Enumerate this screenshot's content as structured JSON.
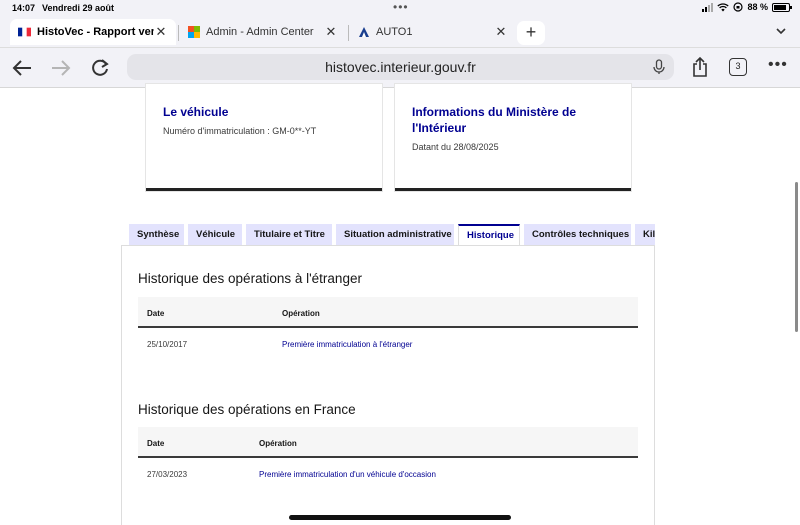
{
  "status": {
    "time": "14:07",
    "date": "Vendredi 29 août",
    "battery": "88 %",
    "battery_level": 0.88
  },
  "browser": {
    "tabs": [
      {
        "title": "HistoVec - Rapport vendeur",
        "icon": "french-flag-icon"
      },
      {
        "title": "Admin - Admin Center",
        "icon": "office-logo-icon"
      },
      {
        "title": "AUTO1",
        "icon": "auto1-logo-icon"
      }
    ],
    "url": "histovec.interieur.gouv.fr",
    "tab_count": "3"
  },
  "cards": {
    "vehicle": {
      "title": "Le véhicule",
      "subtitle": "Numéro d'immatriculation : GM-0**-YT"
    },
    "ministry": {
      "title": "Informations du Ministère de l'Intérieur",
      "subtitle": "Datant du 28/08/2025"
    }
  },
  "nav_tabs": [
    "Synthèse",
    "Véhicule",
    "Titulaire et Titre",
    "Situation administrative",
    "Historique",
    "Contrôles techniques",
    "Kilométrage"
  ],
  "active_nav_tab": "Historique",
  "history_abroad": {
    "title": "Historique des opérations à l'étranger",
    "columns": [
      "Date",
      "Opération"
    ],
    "rows": [
      {
        "date": "25/10/2017",
        "operation": "Première immatriculation à l'étranger"
      }
    ]
  },
  "history_france": {
    "title": "Historique des opérations en France",
    "columns": [
      "Date",
      "Opération"
    ],
    "rows": [
      {
        "date": "27/03/2023",
        "operation": "Première immatriculation d'un véhicule d'occasion"
      }
    ]
  },
  "colors": {
    "primary": "#000091",
    "tab_bg": "#e3e3fd",
    "text": "#161616"
  }
}
